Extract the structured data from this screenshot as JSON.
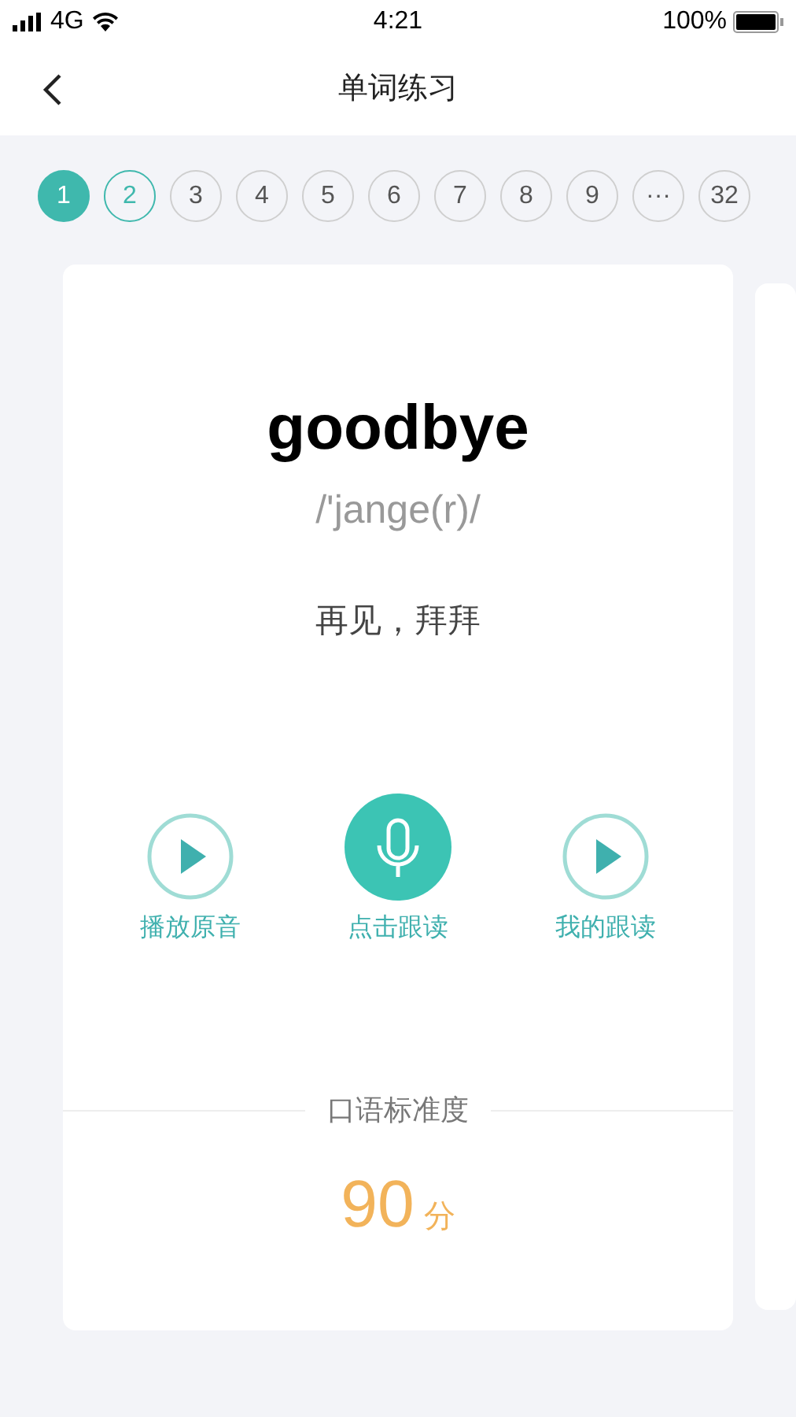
{
  "status_bar": {
    "network": "4G",
    "time": "4:21",
    "battery": "100%"
  },
  "nav": {
    "title": "单词练习"
  },
  "pages": [
    {
      "label": "1",
      "selected": true,
      "attempted": false
    },
    {
      "label": "2",
      "selected": false,
      "attempted": true
    },
    {
      "label": "3",
      "selected": false,
      "attempted": false
    },
    {
      "label": "4",
      "selected": false,
      "attempted": false
    },
    {
      "label": "5",
      "selected": false,
      "attempted": false
    },
    {
      "label": "6",
      "selected": false,
      "attempted": false
    },
    {
      "label": "7",
      "selected": false,
      "attempted": false
    },
    {
      "label": "8",
      "selected": false,
      "attempted": false
    },
    {
      "label": "9",
      "selected": false,
      "attempted": false
    },
    {
      "label": "···",
      "selected": false,
      "attempted": false
    },
    {
      "label": "32",
      "selected": false,
      "attempted": false
    }
  ],
  "card": {
    "word": "goodbye",
    "phonetic": "/'jange(r)/",
    "meaning": "再见，拜拜",
    "actions": [
      {
        "kind": "play",
        "label": "播放原音"
      },
      {
        "kind": "record",
        "label": "点击跟读"
      },
      {
        "kind": "play",
        "label": "我的跟读"
      }
    ],
    "score_label": "口语标准度",
    "score": "90",
    "score_unit": "分"
  }
}
